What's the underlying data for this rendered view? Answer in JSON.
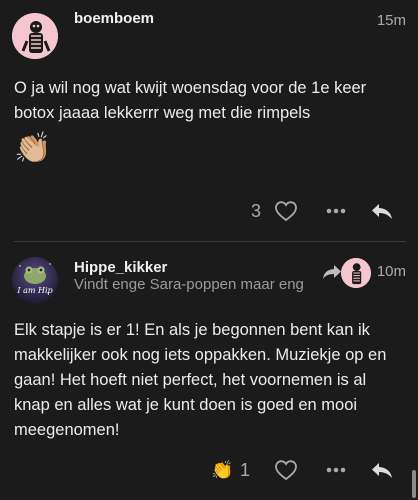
{
  "posts": [
    {
      "username": "boemboem",
      "timestamp": "15m",
      "body": "O ja wil nog wat kwijt woensdag voor de 1e keer botox jaaaa lekkerrr weg met die rimpels",
      "emoji": "👏🏼",
      "like_count": "3",
      "icons": [
        "heart-icon",
        "more-icon",
        "reply-icon"
      ]
    },
    {
      "username": "Hippe_kikker",
      "subtitle": "Vindt enge Sara-poppen maar eng",
      "avatar_text": "I am Hip",
      "timestamp": "10m",
      "body": "Elk stapje is er 1! En als je begonnen bent kan ik makkelijker ook nog iets oppakken. Muziekje op en gaan! Het hoeft niet perfect, het voornemen is al knap en alles wat je kunt doen is goed en mooi meegenomen!",
      "reaction_emoji": "👏",
      "reaction_count": "1",
      "icons": [
        "reply-to-arrow-icon",
        "heart-icon",
        "more-icon",
        "reply-icon"
      ]
    }
  ],
  "colors": {
    "background": "#1b1b1b",
    "text": "#ececec",
    "muted": "#a9a9a9",
    "avatar_pink": "#f5c6d0"
  }
}
